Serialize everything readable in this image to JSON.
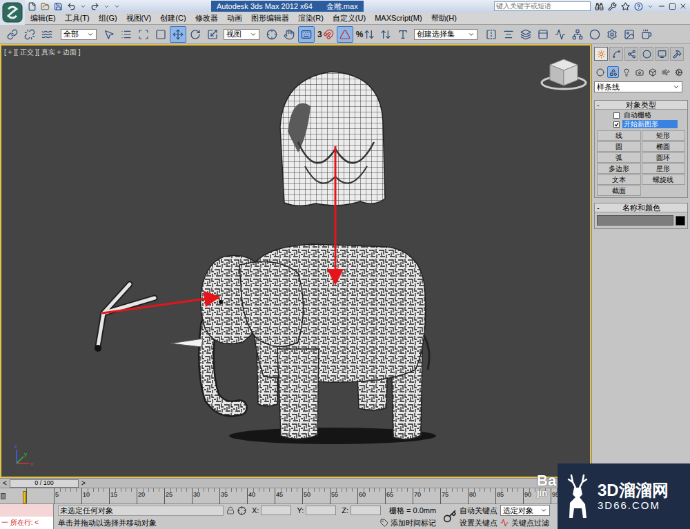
{
  "window": {
    "title": "Autodesk 3ds Max  2012 x64",
    "file": "金雕.max"
  },
  "search": {
    "placeholder": "键入关键字或短语"
  },
  "menu": [
    "编辑(E)",
    "工具(T)",
    "组(G)",
    "视图(V)",
    "创建(C)",
    "修改器",
    "动画",
    "图形编辑器",
    "渲染(R)",
    "自定义(U)",
    "MAXScript(M)",
    "帮助(H)"
  ],
  "toolbar": {
    "selection_filter": "全部",
    "reference_coord": "视图",
    "named_selection": "创建选择集",
    "buttons": [
      {
        "selected": false
      },
      {
        "selected": false
      },
      {
        "selected": false
      },
      {
        "selected": false
      },
      {
        "selected": false
      },
      {
        "selected": false
      },
      {
        "selected": false
      },
      {
        "selected": true
      },
      {
        "selected": false
      },
      {
        "selected": false
      },
      {
        "selected": false
      },
      {
        "selected": false
      },
      {
        "selected": true
      },
      {
        "label": "3",
        "selected": false
      },
      {
        "selected": true
      },
      {
        "label": "%",
        "selected": false
      },
      {
        "selected": false
      },
      {
        "selected": false
      },
      {
        "selected": false
      },
      {
        "selected": false
      },
      {
        "selected": false
      },
      {
        "selected": false
      },
      {
        "selected": false
      },
      {
        "selected": false
      },
      {
        "selected": false
      },
      {
        "selected": false
      },
      {
        "selected": false
      },
      {
        "selected": false
      }
    ]
  },
  "viewport": {
    "label": "[ + ][ 正交 ][ 真实 + 边面 ]",
    "active": true,
    "axes": [
      "x",
      "y",
      "z"
    ]
  },
  "command_panel": {
    "tabs": [
      {
        "selected": true
      },
      {
        "selected": false
      },
      {
        "selected": false
      },
      {
        "selected": false
      },
      {
        "selected": false
      },
      {
        "selected": false
      }
    ],
    "categories": [
      {
        "selected": false
      },
      {
        "selected": true
      },
      {
        "selected": false
      },
      {
        "selected": false
      },
      {
        "selected": false
      },
      {
        "selected": false
      },
      {
        "selected": false
      }
    ],
    "dropdown": "样条线",
    "object_type": {
      "title": "对象类型",
      "collapse": "-",
      "options": [
        {
          "label": "自动栅格",
          "checked": false
        },
        {
          "label": "开始新图形",
          "checked": true
        }
      ],
      "buttons": [
        "线",
        "矩形",
        "圆",
        "椭圆",
        "弧",
        "圆环",
        "多边形",
        "星形",
        "文本",
        "螺旋线",
        "截面"
      ]
    },
    "name_color": {
      "title": "名称和颜色",
      "collapse": "-",
      "name": "",
      "color": "#000000"
    }
  },
  "time_slider": {
    "position": "0 / 100",
    "prev": "<",
    "next": ">"
  },
  "track_bar": {
    "ticks": [
      "5",
      "10",
      "15",
      "20",
      "25",
      "30",
      "35",
      "40",
      "45",
      "50",
      "55",
      "60",
      "65",
      "70",
      "75",
      "80",
      "85",
      "90",
      "95"
    ]
  },
  "status_bar": {
    "script_listener": "一 所在行: <",
    "selection": "未选定任何对象",
    "x_label": "X:",
    "y_label": "Y:",
    "z_label": "Z:",
    "x": "",
    "y": "",
    "z": "",
    "grid": "栅格 = 0.0mm",
    "auto_key": "自动关键点",
    "key_target": "选定对象",
    "prompt": "单击并拖动以选择并移动对象",
    "add_time_tag": "添加时间标记",
    "set_key": "设置关键点",
    "key_filters": "关键点过滤"
  },
  "watermarks": {
    "baidu": [
      "Ba",
      "jin"
    ],
    "site": "3D溜溜网",
    "site_url": "3D66.COM"
  }
}
